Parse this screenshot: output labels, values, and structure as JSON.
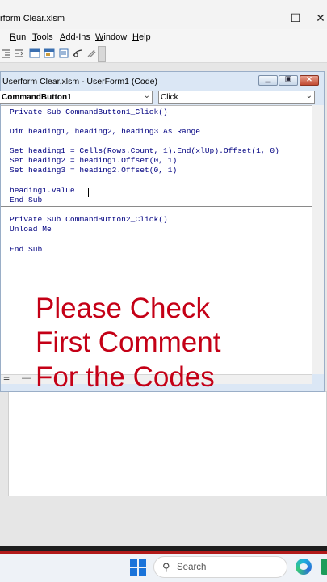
{
  "app": {
    "title": "rform Clear.xlsm",
    "controls": {
      "minimize": "—",
      "maximize": "☐",
      "close": "✕"
    }
  },
  "menu": [
    {
      "label": "Run",
      "key": "R",
      "rest": "un"
    },
    {
      "label": "Tools",
      "key": "T",
      "rest": "ools"
    },
    {
      "label": "Add-Ins",
      "key": "A",
      "rest": "dd-Ins"
    },
    {
      "label": "Window",
      "key": "W",
      "rest": "indow"
    },
    {
      "label": "Help",
      "key": "H",
      "rest": "elp"
    }
  ],
  "code_window": {
    "title": "Userform Clear.xlsm - UserForm1 (Code)",
    "object_combo": "CommandButton1",
    "proc_combo": "Click",
    "lines": [
      "Private Sub CommandButton1_Click()",
      "",
      "Dim heading1, heading2, heading3 As Range",
      "",
      "Set heading1 = Cells(Rows.Count, 1).End(xlUp).Offset(1, 0)",
      "Set heading2 = heading1.Offset(0, 1)",
      "Set heading3 = heading2.Offset(0, 1)",
      "",
      "heading1.value",
      "End Sub",
      "Private Sub CommandButton2_Click()",
      "Unload Me",
      "",
      "End Sub"
    ]
  },
  "overlay": {
    "line1": "Please Check",
    "line2": "First Comment",
    "line3": "For the Codes",
    "color": "#c40016"
  },
  "taskbar": {
    "search_placeholder": "Search",
    "icons": [
      "windows-start-icon",
      "search-icon",
      "edge-icon"
    ]
  }
}
